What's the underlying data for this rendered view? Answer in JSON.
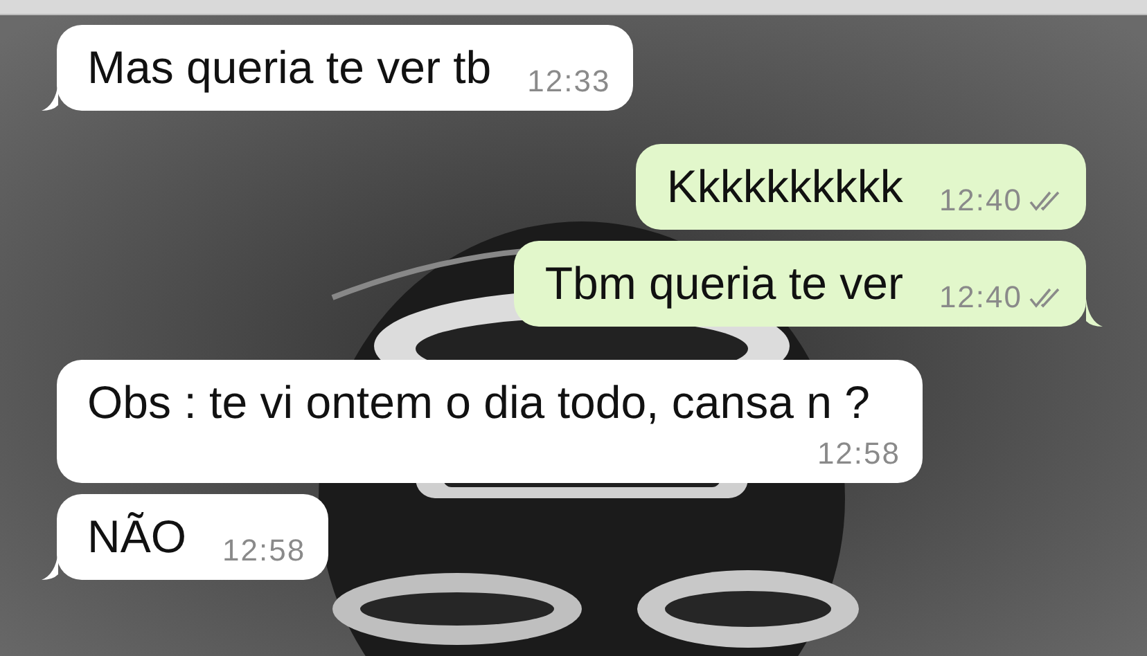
{
  "messages": [
    {
      "kind": "incoming",
      "text": "Mas queria te ver tb",
      "time": "12:33",
      "tail": true
    },
    {
      "kind": "outgoing",
      "text": "Kkkkkkkkkk",
      "time": "12:40",
      "read": false,
      "tail": false
    },
    {
      "kind": "outgoing",
      "text": "Tbm queria te ver",
      "time": "12:40",
      "read": false,
      "tail": true
    },
    {
      "kind": "incoming",
      "text": "Obs : te vi ontem o dia todo, cansa n ?",
      "time": "12:58",
      "tail": false
    },
    {
      "kind": "incoming",
      "text": "NÃO",
      "time": "12:58",
      "tail": true
    }
  ]
}
